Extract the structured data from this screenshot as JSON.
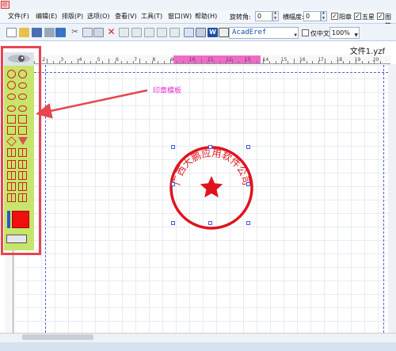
{
  "window": {
    "app_icon_text": "印章",
    "document_tab": "文件1.yzf"
  },
  "menu": {
    "items": [
      "文件(F)",
      "编辑(E)",
      "排版(P)",
      "选项(O)",
      "查看(V)",
      "工具(T)",
      "窗口(W)",
      "帮助(H)"
    ]
  },
  "props": {
    "rotation_label": "旋转角:",
    "rotation_value": "0",
    "aspect_label": "横幅度:",
    "aspect_value": "0",
    "cb_yang": "阳章",
    "cb_star": "五星",
    "cb_pattern": "图符"
  },
  "toolbar": {
    "font_name": "AcadEref",
    "only_chinese_label": "仅中文",
    "zoom_value": "100%"
  },
  "ruler": {
    "top_ticks": [
      "1",
      "2",
      "3",
      "4",
      "5",
      "6",
      "7",
      "8",
      "9",
      "10",
      "11",
      "12",
      "13",
      "14",
      "15",
      "16",
      "17",
      "18",
      "19",
      "20"
    ]
  },
  "annotation": {
    "label": "印章模板",
    "color": "#e22fd1",
    "arrow_color": "#e8454f"
  },
  "seal": {
    "text": "广西大鹏应用软件公司",
    "color": "#e0141e"
  },
  "palette": {
    "highlight_color": "#e8454f",
    "background": "#c6e56b"
  }
}
